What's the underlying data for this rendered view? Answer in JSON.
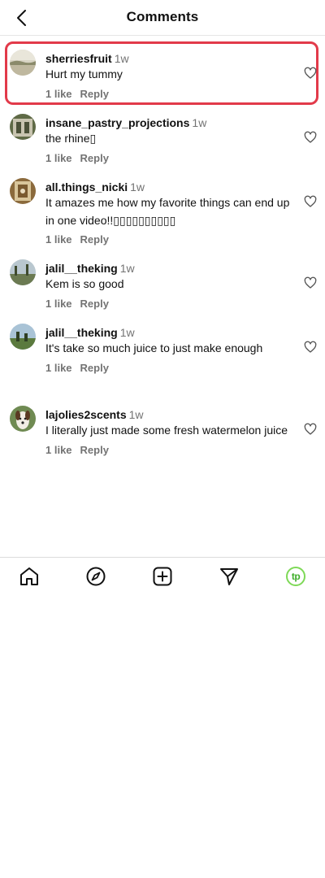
{
  "header": {
    "title": "Comments",
    "back_icon": "chevron-left-icon"
  },
  "comments": [
    {
      "username": "sherriesfruit",
      "time": "1w",
      "text": "Hurt my tummy",
      "likes": "1 like",
      "reply": "Reply",
      "highlighted": true
    },
    {
      "username": "insane_pastry_projections",
      "time": "1w",
      "text": "the rhine▯",
      "likes": "1 like",
      "reply": "Reply"
    },
    {
      "username": "all.things_nicki",
      "time": "1w",
      "text": "It amazes me how my favorite things can end up in one video!!▯▯▯▯▯▯▯▯▯▯",
      "likes": "1 like",
      "reply": "Reply"
    },
    {
      "username": "jalil__theking",
      "time": "1w",
      "text": "Kem is so good",
      "likes": "1 like",
      "reply": "Reply"
    },
    {
      "username": "jalil__theking",
      "time": "1w",
      "text": "It's take so much juice to just make enough",
      "likes": "1 like",
      "reply": "Reply"
    },
    {
      "username": "lajolies2scents",
      "time": "1w",
      "text": "I literally just made some fresh watermelon juice",
      "likes": "1 like",
      "reply": "Reply"
    }
  ],
  "nav": {
    "items": [
      "home-icon",
      "explore-compass-icon",
      "create-plus-icon",
      "direct-send-icon",
      "profile-avatar"
    ],
    "profile_initials": "tp",
    "profile_color": "#7ed957"
  },
  "colors": {
    "highlight": "#e23a4a",
    "muted": "#737373"
  }
}
